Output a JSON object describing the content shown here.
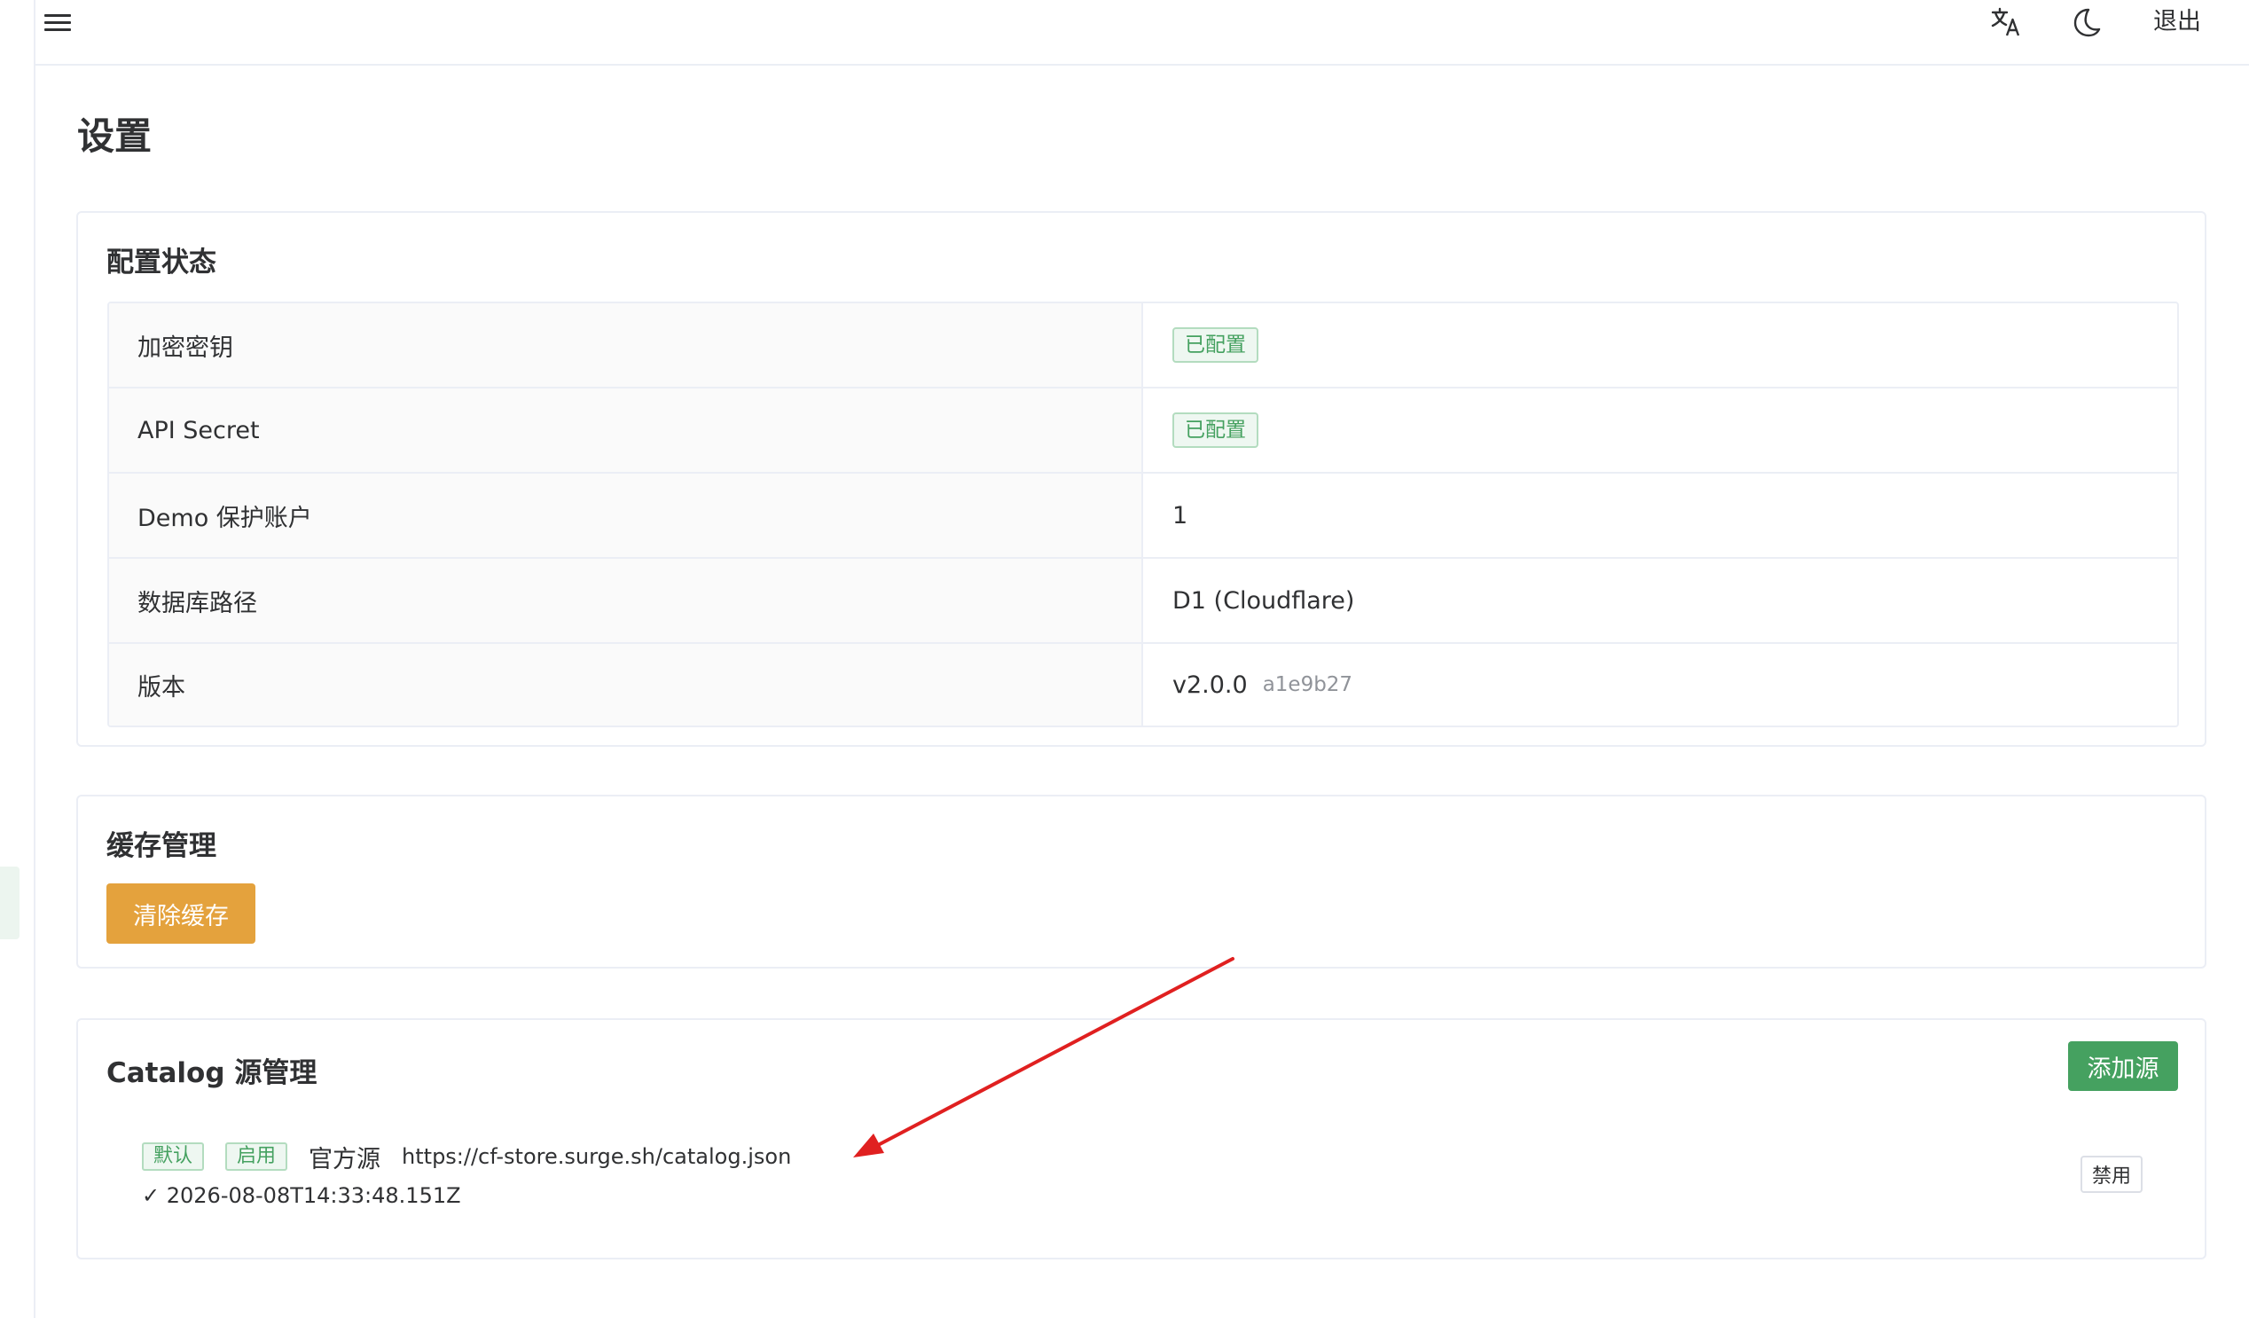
{
  "header": {
    "menu_icon": "hamburger-menu-icon",
    "translate_icon": "translate-icon",
    "theme_icon": "moon-icon",
    "logout_label": "退出"
  },
  "page": {
    "title": "设置"
  },
  "config_status": {
    "title": "配置状态",
    "rows": [
      {
        "label": "加密密钥",
        "value": "已配置"
      },
      {
        "label": "API Secret",
        "value": "已配置"
      },
      {
        "label": "Demo 保护账户",
        "value": "1"
      },
      {
        "label": "数据库路径",
        "value": "D1 (Cloudflare)"
      },
      {
        "label": "版本",
        "value": "v2.0.0",
        "hash": "a1e9b27"
      }
    ]
  },
  "cache": {
    "title": "缓存管理",
    "clear_label": "清除缓存"
  },
  "catalog": {
    "title": "Catalog 源管理",
    "add_label": "添加源",
    "sources": [
      {
        "default_tag": "默认",
        "enabled_tag": "启用",
        "name": "官方源",
        "url": "https://cf-store.surge.sh/catalog.json",
        "synced": "✓ 2026-08-08T14:33:48.151Z",
        "disable_label": "禁用"
      }
    ]
  },
  "colors": {
    "primary_green": "#45a160",
    "warning_orange": "#e4a23d",
    "annotation_red": "#e02020"
  }
}
